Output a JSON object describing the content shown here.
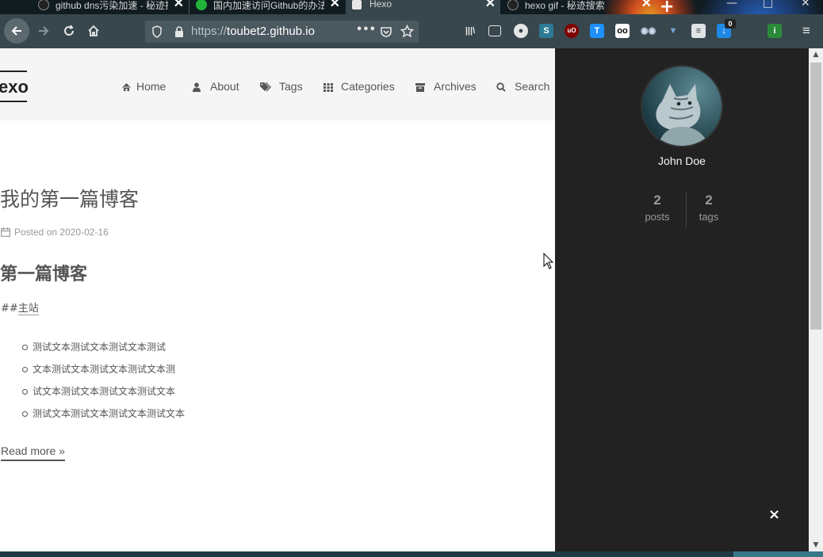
{
  "browser": {
    "tabs": [
      {
        "title": "github dns污染加速 - 秘迹搜索",
        "icon": "search-favicon"
      },
      {
        "title": "国内加速访问Github的办法，超级简单",
        "icon": "wechat-favicon"
      },
      {
        "title": "Hexo",
        "icon": "hexo-favicon",
        "active": true
      },
      {
        "title": "hexo gif - 秘迹搜索",
        "icon": "search-favicon"
      }
    ],
    "new_tab": "+",
    "url_protocol": "https://",
    "url_host": "toubet2.github.io",
    "url_more": "•••",
    "ext_badge": "0"
  },
  "site": {
    "brand": "exo",
    "menu": [
      {
        "label": "Home",
        "icon": "home-icon"
      },
      {
        "label": "About",
        "icon": "user-icon"
      },
      {
        "label": "Tags",
        "icon": "tags-icon"
      },
      {
        "label": "Categories",
        "icon": "th-icon"
      },
      {
        "label": "Archives",
        "icon": "archive-icon"
      },
      {
        "label": "Search",
        "icon": "search-icon"
      }
    ]
  },
  "post": {
    "title": "我的第一篇博客",
    "meta_prefix": "Posted on",
    "date": "2020-02-16",
    "heading": "第一篇博客",
    "line_hashes": "##",
    "line_link": "主站",
    "bullets": [
      "测试文本测试文本测试文本测试",
      "文本测试文本测试文本测试文本测",
      "试文本测试文本测试文本测试文本",
      "测试文本测试文本测试文本测试文本"
    ],
    "read_more": "Read more »"
  },
  "sidebar": {
    "author": "John Doe",
    "posts_count": "2",
    "posts_label": "posts",
    "tags_count": "2",
    "tags_label": "tags",
    "close": "×"
  },
  "colors": {
    "sidebar_bg": "#222222",
    "header_bg": "#f5f5f5",
    "text": "#555555",
    "browser_chrome": "#38474d"
  }
}
